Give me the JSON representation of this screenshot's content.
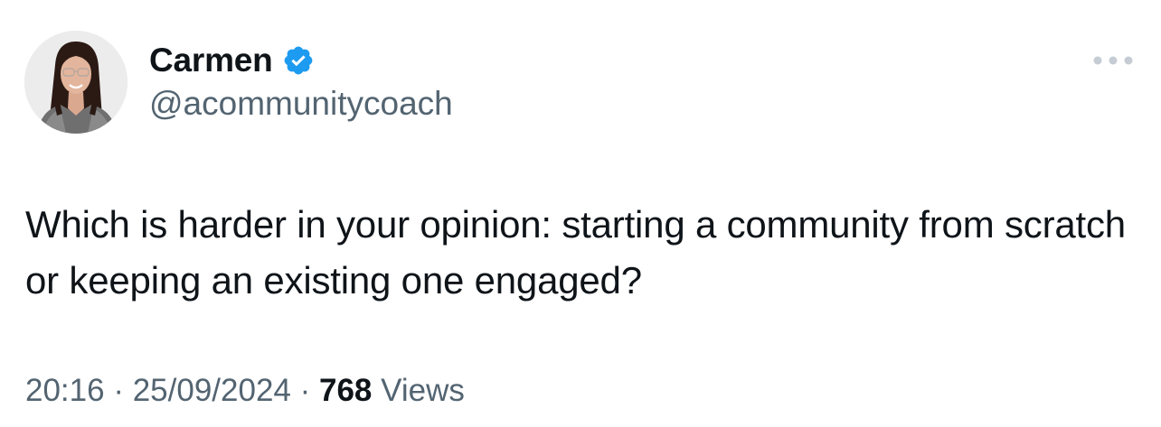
{
  "author": {
    "display_name": "Carmen",
    "handle": "@acommunitycoach",
    "verified": true,
    "verified_color": "#1d9bf0"
  },
  "tweet": {
    "text": "Which is harder in your opinion: starting a community from scratch or keeping an existing one engaged?"
  },
  "meta": {
    "time": "20:16",
    "separator": " · ",
    "date": "25/09/2024",
    "views_count": "768",
    "views_label": "Views"
  },
  "icons": {
    "more": "more-horizontal-icon",
    "verified": "verified-badge-icon"
  },
  "colors": {
    "text_primary": "#0f1419",
    "text_secondary": "#536471",
    "more_icon": "#c5ccd3",
    "background": "#ffffff"
  }
}
